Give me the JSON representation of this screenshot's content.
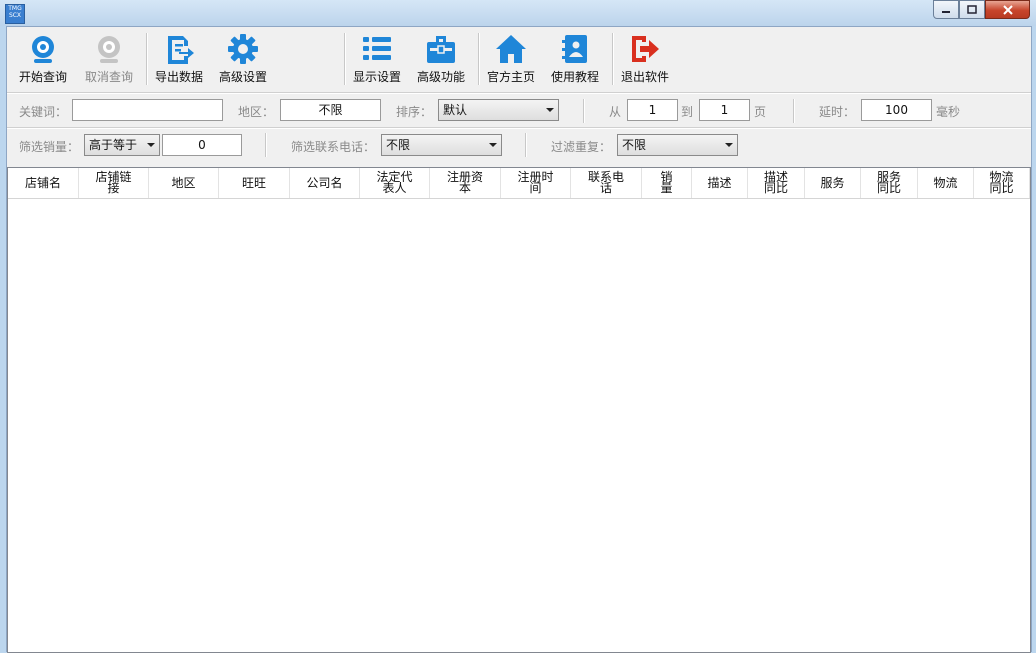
{
  "window": {
    "icon_text": "TMG SCX"
  },
  "toolbar": {
    "start": "开始查询",
    "cancel": "取消查询",
    "export": "导出数据",
    "advanced_settings": "高级设置",
    "display_settings": "显示设置",
    "advanced_functions": "高级功能",
    "homepage": "官方主页",
    "tutorial": "使用教程",
    "exit": "退出软件"
  },
  "filters": {
    "keyword_label": "关键词：",
    "keyword_value": "",
    "region_label": "地区：",
    "region_value": "不限",
    "sort_label": "排序：",
    "sort_value": "默认",
    "from_label": "从",
    "from_value": "1",
    "to_label": "到",
    "to_value": "1",
    "page_label": "页",
    "delay_label": "延时：",
    "delay_value": "100",
    "delay_unit": "毫秒",
    "sales_label": "筛选销量：",
    "sales_op": "高于等于",
    "sales_value": "0",
    "phone_label": "筛选联系电话：",
    "phone_value": "不限",
    "dup_label": "过滤重复：",
    "dup_value": "不限"
  },
  "table": {
    "columns": [
      "店铺名",
      "店铺链接",
      "地区",
      "旺旺",
      "公司名",
      "法定代表人",
      "注册资本",
      "注册时间",
      "联系电话",
      "销量",
      "描述",
      "描述同比",
      "服务",
      "服务同比",
      "物流",
      "物流同比"
    ]
  },
  "colors": {
    "title_bg": "#bcd6ee",
    "frame_bg": "#f0f0f0",
    "accent_blue": "#1f86d8",
    "exit_red": "#d9301f"
  }
}
